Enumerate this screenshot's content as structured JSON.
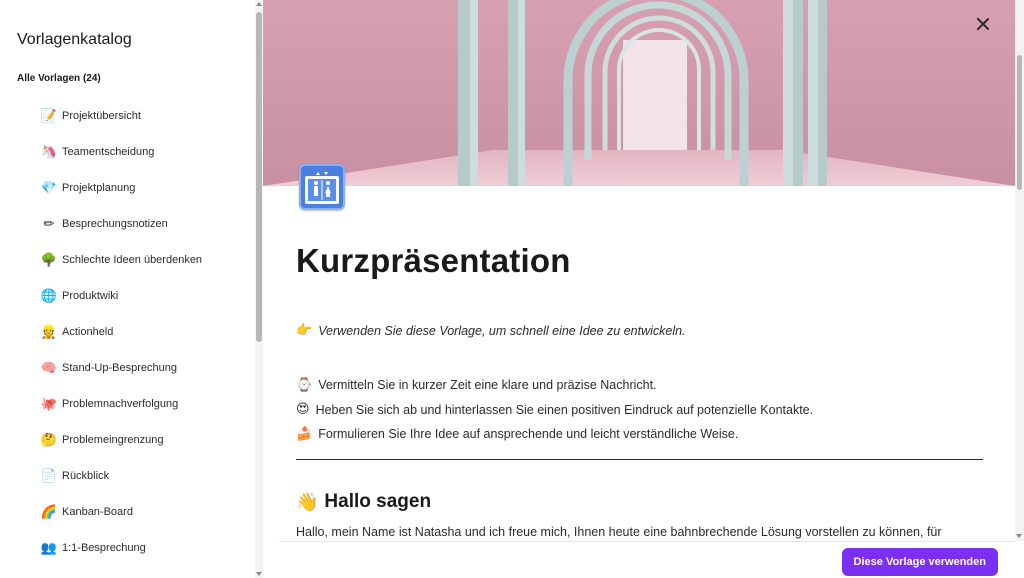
{
  "sidebar": {
    "title": "Vorlagenkatalog",
    "section_label": "Alle Vorlagen (24)",
    "items": [
      {
        "label": "Projektübersicht",
        "icon": "memo-icon",
        "glyph": "📝"
      },
      {
        "label": "Teamentscheidung",
        "icon": "unicorn-icon",
        "glyph": "🦄"
      },
      {
        "label": "Projektplanung",
        "icon": "gem-icon",
        "glyph": "💎"
      },
      {
        "label": "Besprechungsnotizen",
        "icon": "pencil-icon",
        "glyph": "✏"
      },
      {
        "label": "Schlechte Ideen überdenken",
        "icon": "tree-icon",
        "glyph": "🌳"
      },
      {
        "label": "Produktwiki",
        "icon": "globe-icon",
        "glyph": "🌐"
      },
      {
        "label": "Actionheld",
        "icon": "person-icon",
        "glyph": "👷"
      },
      {
        "label": "Stand-Up-Besprechung",
        "icon": "brain-icon",
        "glyph": "🧠"
      },
      {
        "label": "Problemnachverfolgung",
        "icon": "octopus-icon",
        "glyph": "🐙"
      },
      {
        "label": "Problemeingrenzung",
        "icon": "thinking-face-icon",
        "glyph": "🤔"
      },
      {
        "label": "Rückblick",
        "icon": "document-icon",
        "glyph": "📄"
      },
      {
        "label": "Kanban-Board",
        "icon": "rainbow-icon",
        "glyph": "🌈"
      },
      {
        "label": "1:1-Besprechung",
        "icon": "person-pair-icon",
        "glyph": "👥"
      }
    ]
  },
  "preview": {
    "page_icon": "elevator-sign-icon",
    "title": "Kurzpräsentation",
    "intro": {
      "glyph": "👉",
      "text": "Verwenden Sie diese Vorlage, um schnell eine Idee zu entwickeln."
    },
    "bullets": [
      {
        "glyph": "⌚",
        "icon": "watch-icon",
        "text": "Vermitteln Sie in kurzer Zeit eine klare und präzise Nachricht."
      },
      {
        "glyph": "😍",
        "icon": "star-eyes-icon",
        "text": "Heben Sie sich ab und hinterlassen Sie einen positiven Eindruck auf potenzielle Kontakte."
      },
      {
        "glyph": "🍰",
        "icon": "cake-icon",
        "text": "Formulieren Sie Ihre Idee auf ansprechende und leicht verständliche Weise."
      }
    ],
    "heading": {
      "glyph": "👋",
      "text": "Hallo sagen"
    },
    "body": "Hallo, mein Name ist Natasha und ich freue mich, Ihnen heute eine bahnbrechende Lösung vorstellen zu können, für",
    "use_button": "Diese Vorlage verwenden"
  },
  "colors": {
    "accent": "#7b2ff2",
    "cover_pink": "#d9a3b3",
    "arch": "#bcd0d0"
  }
}
